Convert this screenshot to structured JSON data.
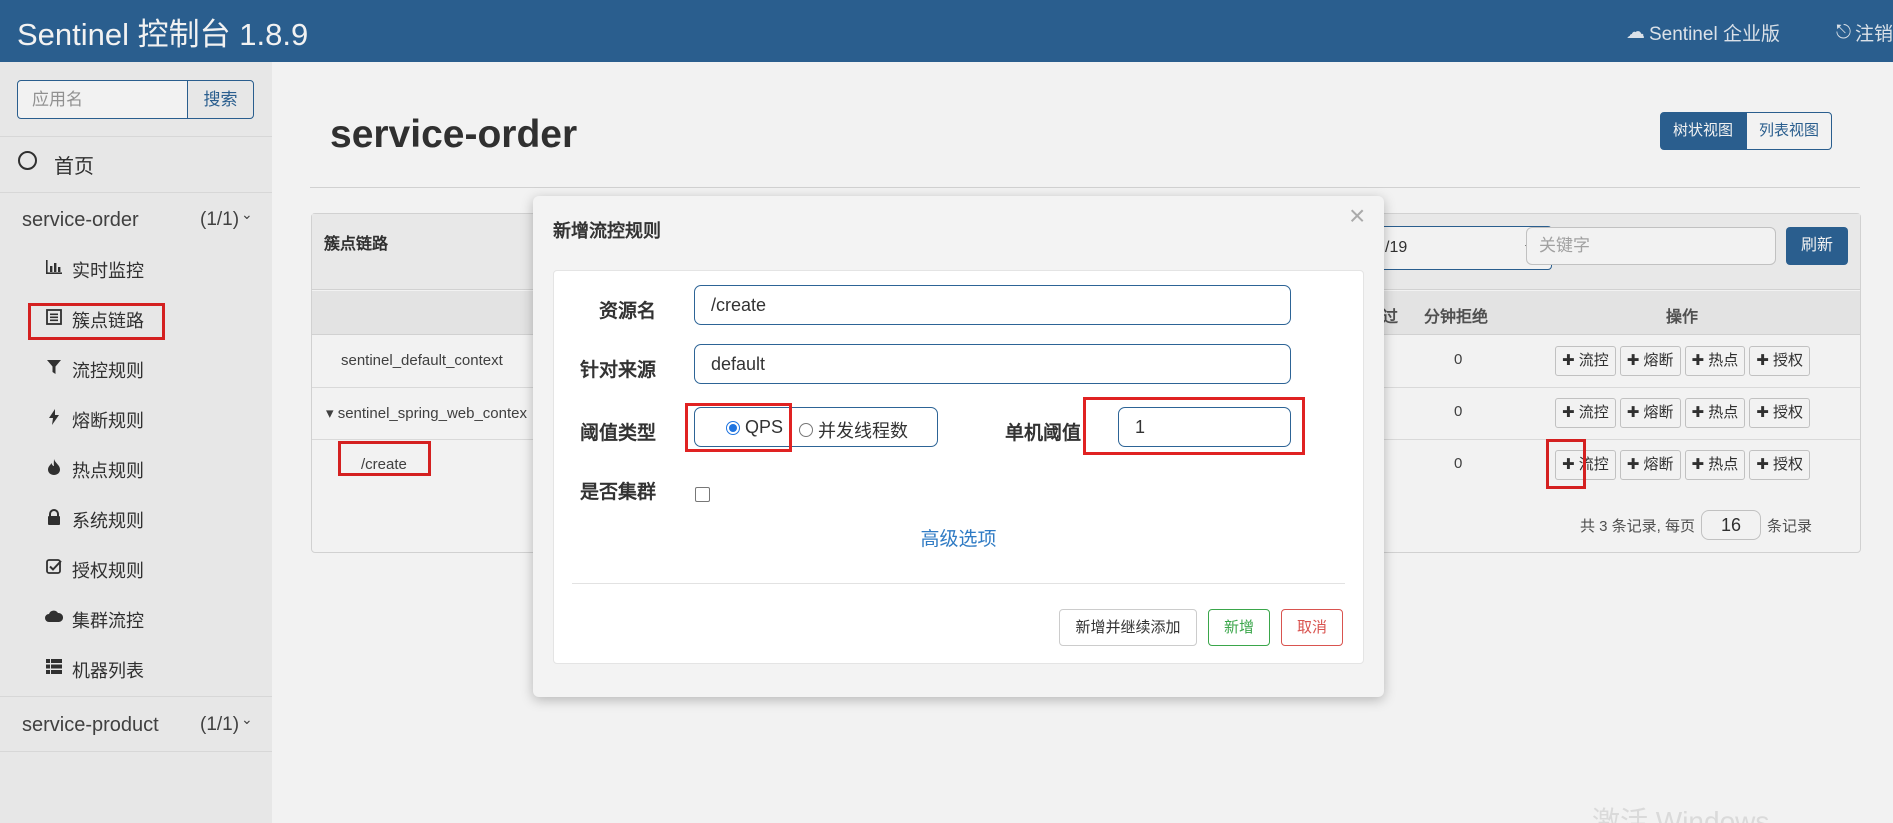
{
  "navbar": {
    "brand": "Sentinel 控制台 1.8.9",
    "enterprise_label": "Sentinel 企业版",
    "logout_label": "注销"
  },
  "sidebar": {
    "search_placeholder": "应用名",
    "search_button": "搜索",
    "home_label": "首页",
    "apps": [
      {
        "name": "service-order",
        "count": "(1/1)",
        "menu": [
          {
            "label": "实时监控",
            "icon": "bar-chart-icon"
          },
          {
            "label": "簇点链路",
            "icon": "list-icon"
          },
          {
            "label": "流控规则",
            "icon": "filter-icon"
          },
          {
            "label": "熔断规则",
            "icon": "flash-icon"
          },
          {
            "label": "热点规则",
            "icon": "fire-icon"
          },
          {
            "label": "系统规则",
            "icon": "lock-icon"
          },
          {
            "label": "授权规则",
            "icon": "check-square-icon"
          },
          {
            "label": "集群流控",
            "icon": "cloud-icon"
          },
          {
            "label": "机器列表",
            "icon": "th-list-icon"
          }
        ]
      },
      {
        "name": "service-product",
        "count": "(1/1)"
      }
    ]
  },
  "main": {
    "title": "service-order",
    "view_tree": "树状视图",
    "view_list": "列表视图",
    "panel_title": "簇点链路",
    "machine_select": "/19",
    "keyword_placeholder": "关键字",
    "refresh": "刷新",
    "columns": {
      "pass_partial": "过",
      "block_per_min": "分钟拒绝",
      "ops": "操作"
    },
    "rows": [
      {
        "name": "sentinel_default_context",
        "block": "0"
      },
      {
        "name": "▾ sentinel_spring_web_contex",
        "block": "0"
      },
      {
        "name": "/create",
        "block": "0"
      }
    ],
    "op_labels": [
      "✚ 流控",
      "✚ 熔断",
      "✚ 热点",
      "✚ 授权"
    ],
    "pager": {
      "prefix": "共 3 条记录, 每页",
      "page_size": "16",
      "suffix": "条记录"
    }
  },
  "modal": {
    "title": "新增流控规则",
    "close": "×",
    "resource_label": "资源名",
    "resource_value": "/create",
    "origin_label": "针对来源",
    "origin_value": "default",
    "grade_label": "阈值类型",
    "grade_options": [
      "QPS",
      "并发线程数"
    ],
    "grade_selected": "QPS",
    "count_label": "单机阈值",
    "count_value": "1",
    "cluster_label": "是否集群",
    "cluster_checked": false,
    "advanced_link": "高级选项",
    "btn_add_continue": "新增并继续添加",
    "btn_add": "新增",
    "btn_cancel": "取消"
  },
  "watermark": "激活 Windows",
  "colors": {
    "navbar": "#2d6496",
    "highlight": "#e02222",
    "link": "#2f7bc4",
    "success": "#3aa64a",
    "danger": "#d9534f"
  }
}
